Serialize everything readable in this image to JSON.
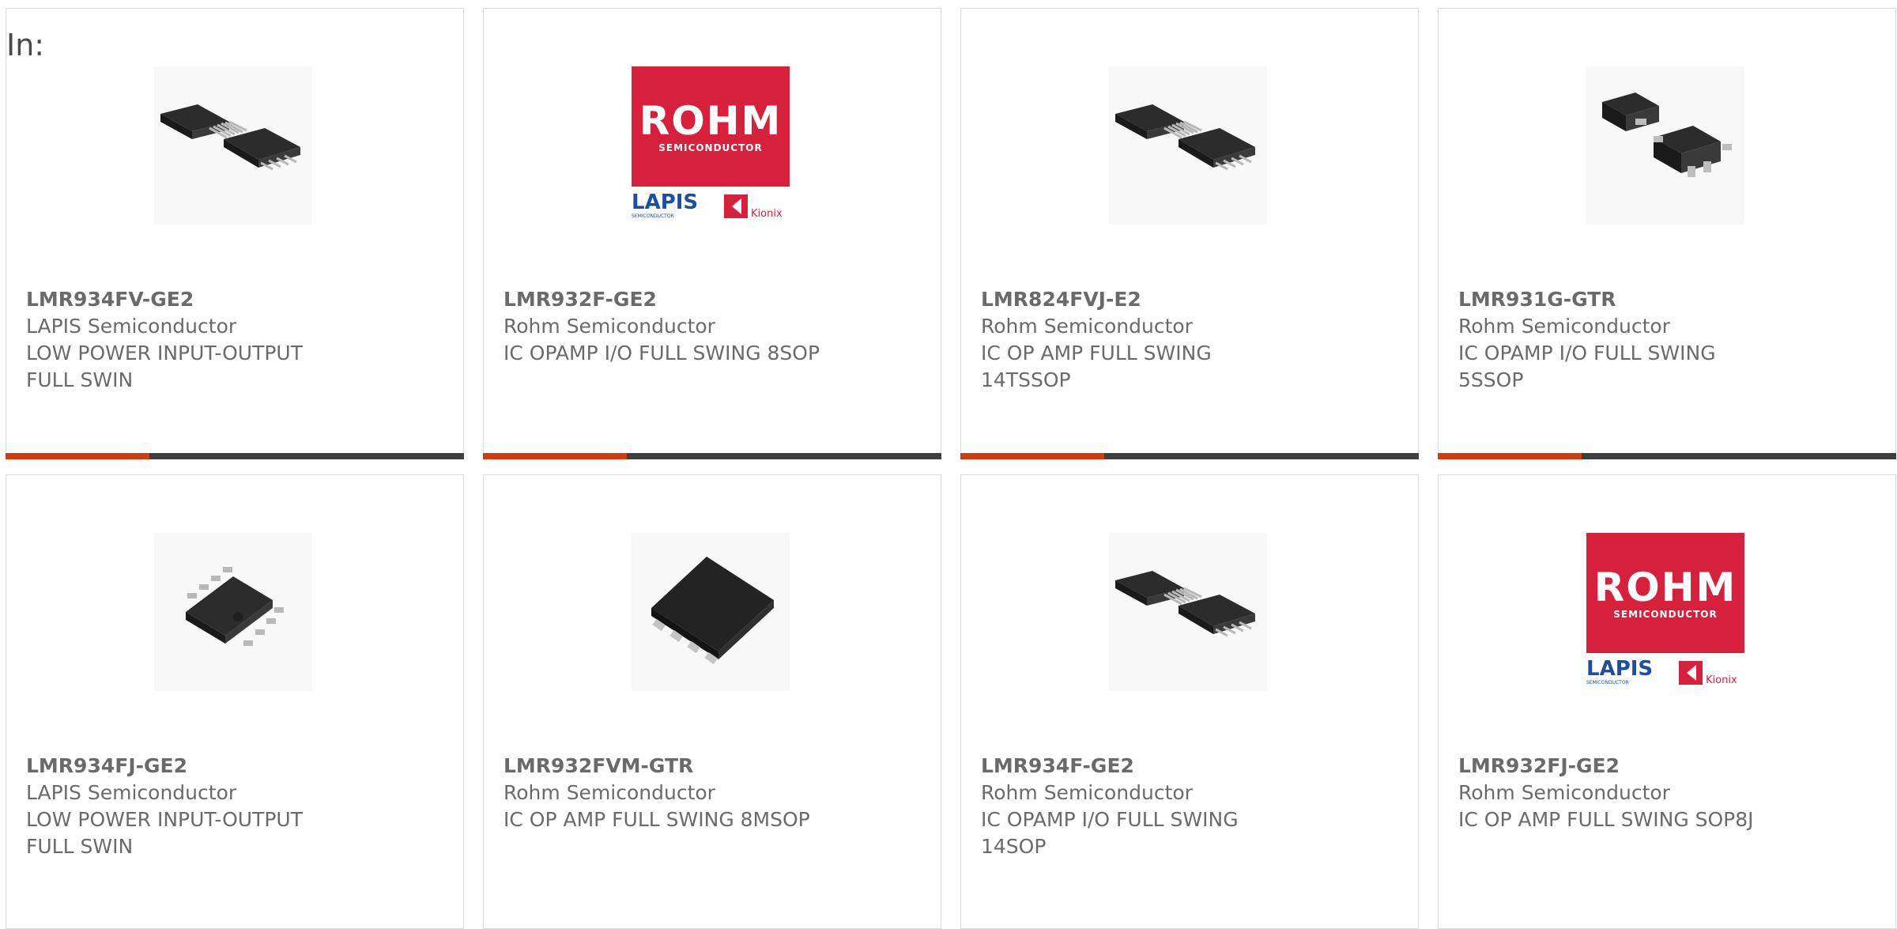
{
  "prefix": "In:",
  "products": [
    {
      "part": "LMR934FV-GE2",
      "manufacturer": "LAPIS Semiconductor",
      "desc1": "LOW POWER INPUT-OUTPUT",
      "desc2": "FULL SWIN",
      "image": "chip-tssop-icon"
    },
    {
      "part": "LMR932F-GE2",
      "manufacturer": "Rohm Semiconductor",
      "desc1": "IC OPAMP I/O FULL SWING 8SOP",
      "desc2": "",
      "image": "rohm-logo"
    },
    {
      "part": "LMR824FVJ-E2",
      "manufacturer": "Rohm Semiconductor",
      "desc1": "IC OP AMP FULL SWING",
      "desc2": "14TSSOP",
      "image": "chip-tssop-icon"
    },
    {
      "part": "LMR931G-GTR",
      "manufacturer": "Rohm Semiconductor",
      "desc1": "IC OPAMP I/O FULL SWING",
      "desc2": "5SSOP",
      "image": "chip-sot-icon"
    },
    {
      "part": "LMR934FJ-GE2",
      "manufacturer": "LAPIS Semiconductor",
      "desc1": "LOW POWER INPUT-OUTPUT",
      "desc2": "FULL SWIN",
      "image": "chip-sop8-icon"
    },
    {
      "part": "LMR932FVM-GTR",
      "manufacturer": "Rohm Semiconductor",
      "desc1": "IC OP AMP FULL SWING 8MSOP",
      "desc2": "",
      "image": "chip-msop-icon"
    },
    {
      "part": "LMR934F-GE2",
      "manufacturer": "Rohm Semiconductor",
      "desc1": "IC OPAMP I/O FULL SWING",
      "desc2": "14SOP",
      "image": "chip-tssop-icon"
    },
    {
      "part": "LMR932FJ-GE2",
      "manufacturer": "Rohm Semiconductor",
      "desc1": "IC OP AMP FULL SWING SOP8J",
      "desc2": "",
      "image": "rohm-logo"
    }
  ],
  "logo": {
    "brand": "ROHM",
    "brand_sub": "SEMICONDUCTOR",
    "lapis": "LAPIS",
    "lapis_sub": "SEMICONDUCTOR",
    "kionix": "Kionix"
  },
  "colors": {
    "accent": "#d33a10",
    "bar": "#3e3e3e",
    "rohm_red": "#d7203b",
    "lapis_blue": "#1c4fa0"
  }
}
